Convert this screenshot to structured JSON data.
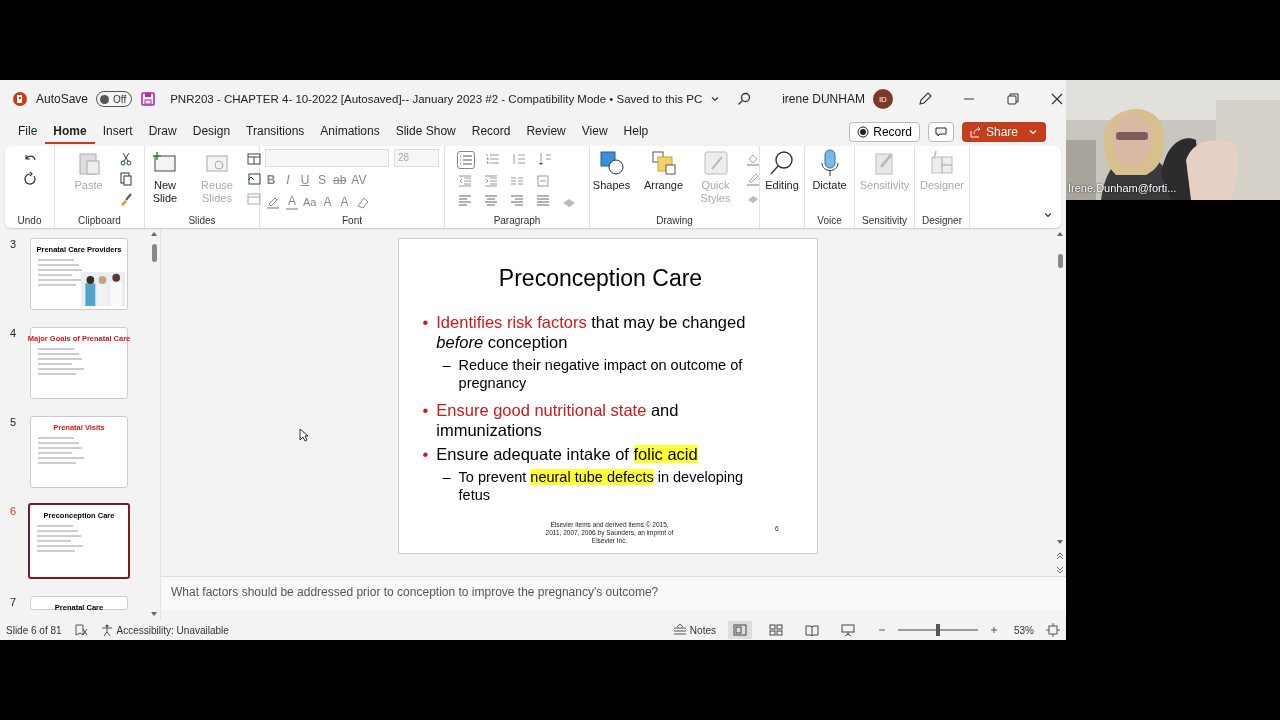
{
  "title_bar": {
    "autosave_label": "AutoSave",
    "autosave": {
      "on": false,
      "label": "Off"
    },
    "document_title": "PNR203 - CHAPTER 4-  10-2022 [Autosaved]--  January 2023 #2  -  Compatibility Mode • Saved to this PC",
    "user_name": "irene DUNHAM",
    "avatar_initials": "ID"
  },
  "menu_tabs": [
    {
      "label": "File",
      "selected": false
    },
    {
      "label": "Home",
      "selected": true
    },
    {
      "label": "Insert",
      "selected": false
    },
    {
      "label": "Draw",
      "selected": false
    },
    {
      "label": "Design",
      "selected": false
    },
    {
      "label": "Transitions",
      "selected": false
    },
    {
      "label": "Animations",
      "selected": false
    },
    {
      "label": "Slide Show",
      "selected": false
    },
    {
      "label": "Record",
      "selected": false
    },
    {
      "label": "Review",
      "selected": false
    },
    {
      "label": "View",
      "selected": false
    },
    {
      "label": "Help",
      "selected": false
    }
  ],
  "record_button": "Record",
  "share_button": "Share",
  "ribbon_groups": [
    {
      "kind": "undo",
      "label": "Undo"
    },
    {
      "kind": "clipboard",
      "label": "Clipboard",
      "tools": [
        {
          "label": "Paste",
          "disabled": true
        }
      ]
    },
    {
      "kind": "slides",
      "label": "Slides",
      "tools": [
        {
          "label": "New Slide",
          "disabled": false
        },
        {
          "label": "Reuse Slides",
          "disabled": true
        }
      ]
    },
    {
      "kind": "font",
      "label": "Font",
      "font_size": "28",
      "format_buttons": [
        "B",
        "I",
        "U",
        "S",
        "ab",
        "AV"
      ],
      "color_buttons": [
        "A",
        "Aa",
        "A",
        "A"
      ]
    },
    {
      "kind": "paragraph",
      "label": "Paragraph"
    },
    {
      "kind": "drawing",
      "label": "Drawing",
      "tools": [
        {
          "label": "Shapes",
          "disabled": false
        },
        {
          "label": "Arrange",
          "disabled": false
        },
        {
          "label": "Quick Styles",
          "disabled": true
        }
      ]
    },
    {
      "kind": "editing",
      "tools": [
        {
          "label": "Editing",
          "disabled": false
        }
      ]
    },
    {
      "kind": "voice",
      "label": "Voice",
      "tools": [
        {
          "label": "Dictate",
          "disabled": false
        }
      ]
    },
    {
      "kind": "sensitivity",
      "label": "Sensitivity",
      "tools": [
        {
          "label": "Sensitivity",
          "disabled": true
        }
      ]
    },
    {
      "kind": "designer",
      "label": "Designer",
      "tools": [
        {
          "label": "Designer",
          "disabled": true
        }
      ]
    }
  ],
  "thumbnails": [
    {
      "number": "3",
      "title": "Prenatal Care Providers",
      "color": "#000000",
      "picture": true,
      "selected": false
    },
    {
      "number": "4",
      "title": "Major Goals of Prenatal Care",
      "color": "#d01818",
      "picture": false,
      "selected": false
    },
    {
      "number": "5",
      "title": "Prenatal Visits",
      "color": "#d01818",
      "picture": false,
      "selected": false
    },
    {
      "number": "6",
      "title": "Preconception Care",
      "color": "#000000",
      "picture": false,
      "selected": true
    },
    {
      "number": "7",
      "title": "Prenatal Care",
      "color": "#000000",
      "picture": false,
      "selected": false
    }
  ],
  "slide": {
    "title": "Preconception Care",
    "bullets": [
      {
        "marker": "•",
        "segments": [
          {
            "text": "Identifies risk factors",
            "kind": "key_term"
          },
          {
            "text": " that may be changed ",
            "kind": "plain"
          },
          {
            "text": "before",
            "kind": "stressed"
          },
          {
            "text": " conception",
            "kind": "plain"
          }
        ],
        "children": [
          {
            "marker": "–",
            "segments": [
              {
                "text": "Reduce their negative impact on outcome of pregnancy",
                "kind": "plain"
              }
            ]
          }
        ]
      },
      {
        "marker": "•",
        "segments": [
          {
            "text": "Ensure good nutritional state",
            "kind": "key_term"
          },
          {
            "text": " and immunizations",
            "kind": "plain"
          }
        ]
      },
      {
        "marker": "•",
        "segments": [
          {
            "text": "Ensure adequate intake of ",
            "kind": "plain"
          },
          {
            "text": "folic acid",
            "kind": "highlighted"
          }
        ],
        "children": [
          {
            "marker": "–",
            "segments": [
              {
                "text": "To prevent ",
                "kind": "plain"
              },
              {
                "text": "neural tube defects",
                "kind": "highlighted"
              },
              {
                "text": " in developing fetus",
                "kind": "plain"
              }
            ]
          }
        ]
      }
    ],
    "footer": "Elsevier items and derived items © 2015, 2011, 2007, 2006 by Saunders, an imprint of Elsevier Inc.",
    "page_number": "6"
  },
  "notes": "What factors should be addressed prior to conception to improve the pregnancy's outcome?",
  "status_bar": {
    "slide_counter": "Slide 6 of 81",
    "accessibility": "Accessibility: Unavailable",
    "notes_button": "Notes",
    "views": [
      {
        "selected": true
      },
      {
        "selected": false
      },
      {
        "selected": false
      },
      {
        "selected": false
      }
    ],
    "zoom": {
      "level": 0.5
    },
    "zoom_label": "53%"
  },
  "webcam": {
    "kind": "picture",
    "name": "Irene.Dunham@forti..."
  }
}
